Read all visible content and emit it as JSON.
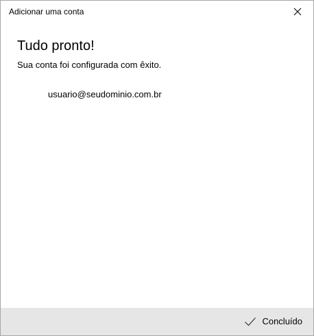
{
  "window": {
    "title": "Adicionar uma conta",
    "close_icon": "close-icon"
  },
  "main": {
    "heading": "Tudo pronto!",
    "subtext": "Sua conta foi configurada com êxito.",
    "account": {
      "email": "usuario@seudominio.com.br"
    }
  },
  "footer": {
    "done_icon": "checkmark-icon",
    "done_label": "Concluído",
    "background_color": "#e6e6e6"
  }
}
